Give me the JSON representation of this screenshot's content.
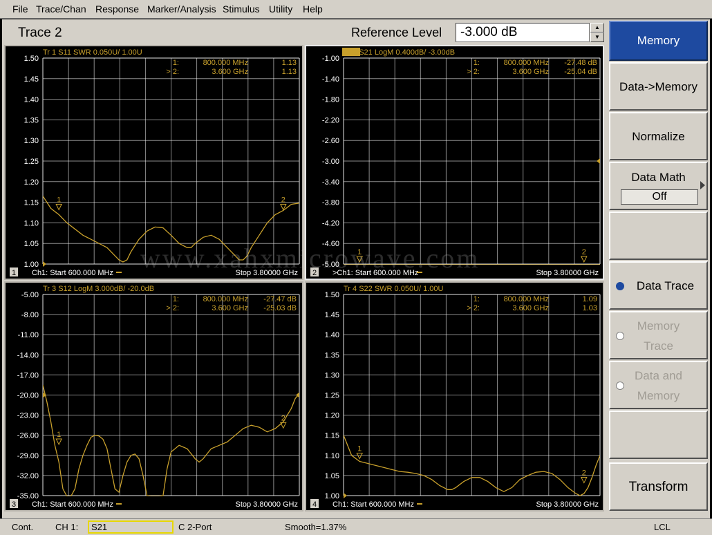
{
  "menu": [
    "File",
    "Trace/Chan",
    "Response",
    "Marker/Analysis",
    "Stimulus",
    "Utility",
    "Help"
  ],
  "header": {
    "active_trace": "Trace 2",
    "ref_label": "Reference Level",
    "ref_value": "-3.000 dB"
  },
  "colors": {
    "trace": "#c8a02c",
    "grid": "#ffffff",
    "softkey_active": "#1e4aa0"
  },
  "panels": [
    {
      "id": "tr1",
      "header": "Tr  1   S11 SWR 0.050U/  1.00U",
      "header_active": false,
      "y_ticks": [
        "1.50",
        "1.45",
        "1.40",
        "1.35",
        "1.30",
        "1.25",
        "1.20",
        "1.15",
        "1.10",
        "1.05",
        "1.00"
      ],
      "y_top": 1.5,
      "y_bottom": 1.0,
      "markers": [
        {
          "sel": " ",
          "num": "1:",
          "freq": "800.000 MHz",
          "val": "1.13"
        },
        {
          "sel": ">",
          "num": "2:",
          "freq": "3.600 GHz",
          "val": "1.13"
        }
      ],
      "channel_num": "1",
      "start_label": "Ch1: Start  600.000 MHz",
      "stop_label": "Stop  3.80000 GHz",
      "ref_arrow_side": "left",
      "trace": [
        [
          600,
          1.165
        ],
        [
          700,
          1.135
        ],
        [
          800,
          1.12
        ],
        [
          900,
          1.1
        ],
        [
          1000,
          1.085
        ],
        [
          1100,
          1.07
        ],
        [
          1200,
          1.06
        ],
        [
          1300,
          1.05
        ],
        [
          1400,
          1.04
        ],
        [
          1500,
          1.02
        ],
        [
          1550,
          1.01
        ],
        [
          1600,
          1.005
        ],
        [
          1650,
          1.01
        ],
        [
          1700,
          1.03
        ],
        [
          1800,
          1.06
        ],
        [
          1900,
          1.08
        ],
        [
          2000,
          1.09
        ],
        [
          2100,
          1.088
        ],
        [
          2200,
          1.07
        ],
        [
          2300,
          1.05
        ],
        [
          2400,
          1.04
        ],
        [
          2450,
          1.04
        ],
        [
          2500,
          1.05
        ],
        [
          2600,
          1.065
        ],
        [
          2700,
          1.07
        ],
        [
          2800,
          1.06
        ],
        [
          2900,
          1.04
        ],
        [
          3000,
          1.02
        ],
        [
          3050,
          1.01
        ],
        [
          3100,
          1.01
        ],
        [
          3150,
          1.02
        ],
        [
          3200,
          1.04
        ],
        [
          3300,
          1.07
        ],
        [
          3400,
          1.1
        ],
        [
          3500,
          1.12
        ],
        [
          3600,
          1.13
        ],
        [
          3700,
          1.145
        ],
        [
          3800,
          1.148
        ]
      ],
      "marker_pts": [
        {
          "label": "1",
          "x": 800,
          "y": 1.13
        },
        {
          "label": "2",
          "x": 3600,
          "y": 1.13
        }
      ]
    },
    {
      "id": "tr2",
      "header": "Tr  2   S21 LogM 0.400dB/  -3.00dB",
      "header_active": true,
      "y_ticks": [
        "-1.00",
        "-1.40",
        "-1.80",
        "-2.20",
        "-2.60",
        "-3.00",
        "-3.40",
        "-3.80",
        "-4.20",
        "-4.60",
        "-5.00"
      ],
      "y_top": -1.0,
      "y_bottom": -5.0,
      "markers": [
        {
          "sel": " ",
          "num": "1:",
          "freq": "800.000 MHz",
          "val": "-27.48 dB"
        },
        {
          "sel": ">",
          "num": "2:",
          "freq": "3.600 GHz",
          "val": "-25.04 dB"
        }
      ],
      "channel_num": "2",
      "start_label": ">Ch1: Start  600.000 MHz",
      "stop_label": "Stop  3.80000 GHz",
      "ref_arrow_side": "right",
      "trace": [
        [
          600,
          -5.05
        ],
        [
          3800,
          -5.05
        ]
      ],
      "marker_pts": [
        {
          "label": "1",
          "x": 800,
          "y": -5.0
        },
        {
          "label": "2",
          "x": 3600,
          "y": -5.0
        }
      ]
    },
    {
      "id": "tr3",
      "header": "Tr  3   S12 LogM 3.000dB/  -20.0dB",
      "header_active": false,
      "y_ticks": [
        "-5.00",
        "-8.00",
        "-11.00",
        "-14.00",
        "-17.00",
        "-20.00",
        "-23.00",
        "-26.00",
        "-29.00",
        "-32.00",
        "-35.00"
      ],
      "y_top": -5.0,
      "y_bottom": -35.0,
      "markers": [
        {
          "sel": " ",
          "num": "1:",
          "freq": "800.000 MHz",
          "val": "-27.47 dB"
        },
        {
          "sel": ">",
          "num": "2:",
          "freq": "3.600 GHz",
          "val": "-25.03 dB"
        }
      ],
      "channel_num": "3",
      "start_label": "Ch1: Start  600.000 MHz",
      "stop_label": "Stop  3.80000 GHz",
      "ref_arrow_side": "both",
      "trace": [
        [
          600,
          -18.5
        ],
        [
          650,
          -21
        ],
        [
          700,
          -24
        ],
        [
          750,
          -27.5
        ],
        [
          800,
          -30
        ],
        [
          850,
          -34
        ],
        [
          900,
          -36
        ],
        [
          950,
          -36
        ],
        [
          1000,
          -34
        ],
        [
          1050,
          -31
        ],
        [
          1100,
          -29
        ],
        [
          1150,
          -27.5
        ],
        [
          1200,
          -26.3
        ],
        [
          1250,
          -26
        ],
        [
          1300,
          -26.1
        ],
        [
          1350,
          -26.6
        ],
        [
          1400,
          -28
        ],
        [
          1450,
          -31
        ],
        [
          1500,
          -34
        ],
        [
          1550,
          -34.5
        ],
        [
          1600,
          -32
        ],
        [
          1650,
          -30
        ],
        [
          1700,
          -29
        ],
        [
          1750,
          -28.8
        ],
        [
          1800,
          -29.5
        ],
        [
          1850,
          -32
        ],
        [
          1900,
          -35
        ],
        [
          1950,
          -36
        ],
        [
          2000,
          -36
        ],
        [
          2050,
          -36
        ],
        [
          2100,
          -35
        ],
        [
          2150,
          -31
        ],
        [
          2200,
          -28.5
        ],
        [
          2300,
          -27.5
        ],
        [
          2400,
          -28
        ],
        [
          2500,
          -29.5
        ],
        [
          2550,
          -30
        ],
        [
          2600,
          -29.5
        ],
        [
          2700,
          -28
        ],
        [
          2800,
          -27.5
        ],
        [
          2900,
          -27
        ],
        [
          3000,
          -26
        ],
        [
          3100,
          -25
        ],
        [
          3200,
          -24.5
        ],
        [
          3300,
          -24.8
        ],
        [
          3400,
          -25.5
        ],
        [
          3500,
          -25
        ],
        [
          3600,
          -24
        ],
        [
          3650,
          -23
        ],
        [
          3700,
          -22
        ],
        [
          3750,
          -20.5
        ],
        [
          3800,
          -19.8
        ]
      ],
      "marker_pts": [
        {
          "label": "1",
          "x": 800,
          "y": -27.47
        },
        {
          "label": "2",
          "x": 3600,
          "y": -25.03
        }
      ]
    },
    {
      "id": "tr4",
      "header": "Tr  4   S22 SWR 0.050U/  1.00U",
      "header_active": false,
      "y_ticks": [
        "1.50",
        "1.45",
        "1.40",
        "1.35",
        "1.30",
        "1.25",
        "1.20",
        "1.15",
        "1.10",
        "1.05",
        "1.00"
      ],
      "y_top": 1.5,
      "y_bottom": 1.0,
      "markers": [
        {
          "sel": " ",
          "num": "1:",
          "freq": "800.000 MHz",
          "val": "1.09"
        },
        {
          "sel": ">",
          "num": "2:",
          "freq": "3.600 GHz",
          "val": "1.03"
        }
      ],
      "channel_num": "4",
      "start_label": "Ch1: Start  600.000 MHz",
      "stop_label": "Stop  3.80000 GHz",
      "ref_arrow_side": "left",
      "trace": [
        [
          600,
          1.15
        ],
        [
          700,
          1.1
        ],
        [
          800,
          1.085
        ],
        [
          900,
          1.08
        ],
        [
          1000,
          1.075
        ],
        [
          1100,
          1.07
        ],
        [
          1200,
          1.065
        ],
        [
          1300,
          1.06
        ],
        [
          1400,
          1.058
        ],
        [
          1500,
          1.055
        ],
        [
          1600,
          1.05
        ],
        [
          1700,
          1.04
        ],
        [
          1800,
          1.025
        ],
        [
          1900,
          1.015
        ],
        [
          1950,
          1.015
        ],
        [
          2000,
          1.02
        ],
        [
          2100,
          1.035
        ],
        [
          2200,
          1.045
        ],
        [
          2300,
          1.045
        ],
        [
          2400,
          1.035
        ],
        [
          2500,
          1.02
        ],
        [
          2600,
          1.01
        ],
        [
          2700,
          1.02
        ],
        [
          2800,
          1.04
        ],
        [
          2900,
          1.05
        ],
        [
          3000,
          1.058
        ],
        [
          3100,
          1.06
        ],
        [
          3200,
          1.055
        ],
        [
          3300,
          1.04
        ],
        [
          3400,
          1.02
        ],
        [
          3500,
          1.005
        ],
        [
          3550,
          1.0
        ],
        [
          3600,
          1.005
        ],
        [
          3650,
          1.02
        ],
        [
          3700,
          1.045
        ],
        [
          3750,
          1.075
        ],
        [
          3800,
          1.1
        ]
      ],
      "marker_pts": [
        {
          "label": "1",
          "x": 800,
          "y": 1.09
        },
        {
          "label": "2",
          "x": 3600,
          "y": 1.03
        }
      ]
    }
  ],
  "softkeys": {
    "memory": "Memory",
    "data_to_memory": "Data->Memory",
    "normalize": "Normalize",
    "data_math": "Data Math",
    "data_math_value": "Off",
    "data_trace": "Data Trace",
    "memory_trace_1": "Memory",
    "memory_trace_2": "Trace",
    "data_and_memory_1": "Data and",
    "data_and_memory_2": "Memory",
    "transform": "Transform"
  },
  "status": {
    "mode": "Cont.",
    "channel": "CH 1:",
    "measurement": "S21",
    "cal": "C  2-Port",
    "smooth": "Smooth=1.37%",
    "remote": "LCL"
  },
  "watermark": "www.xahxmicrowave.com"
}
